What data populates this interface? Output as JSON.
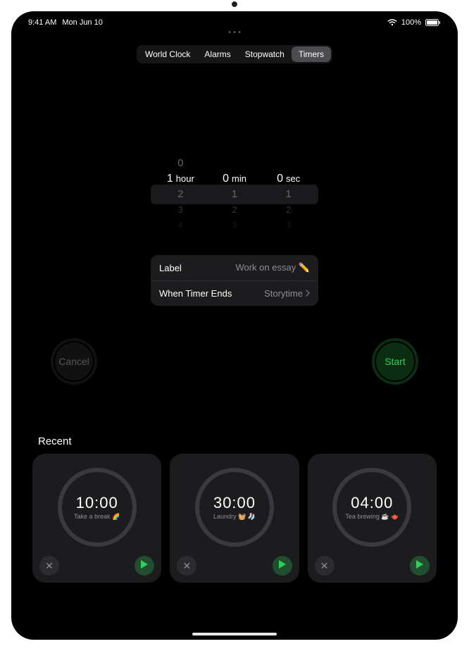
{
  "status": {
    "time": "9:41 AM",
    "date": "Mon Jun 10",
    "battery_pct": "100%"
  },
  "tabs": {
    "items": [
      "World Clock",
      "Alarms",
      "Stopwatch",
      "Timers"
    ],
    "active_index": 3
  },
  "picker": {
    "hours": {
      "selected": "1",
      "unit": "hour",
      "above": [
        "0"
      ],
      "below": [
        "2",
        "3",
        "4"
      ]
    },
    "minutes": {
      "selected": "0",
      "unit": "min",
      "above": [],
      "below": [
        "1",
        "2",
        "3"
      ]
    },
    "seconds": {
      "selected": "0",
      "unit": "sec",
      "above": [],
      "below": [
        "1",
        "2",
        "3"
      ]
    }
  },
  "settings": {
    "label_title": "Label",
    "label_value": "Work on essay ✏️",
    "ends_title": "When Timer Ends",
    "ends_value": "Storytime"
  },
  "buttons": {
    "cancel": "Cancel",
    "start": "Start"
  },
  "recent": {
    "heading": "Recent",
    "items": [
      {
        "time": "10:00",
        "label": "Take a break 🌈"
      },
      {
        "time": "30:00",
        "label": "Laundry 🧺 🧦"
      },
      {
        "time": "04:00",
        "label": "Tea brewing ☕️ 🫖"
      }
    ]
  }
}
